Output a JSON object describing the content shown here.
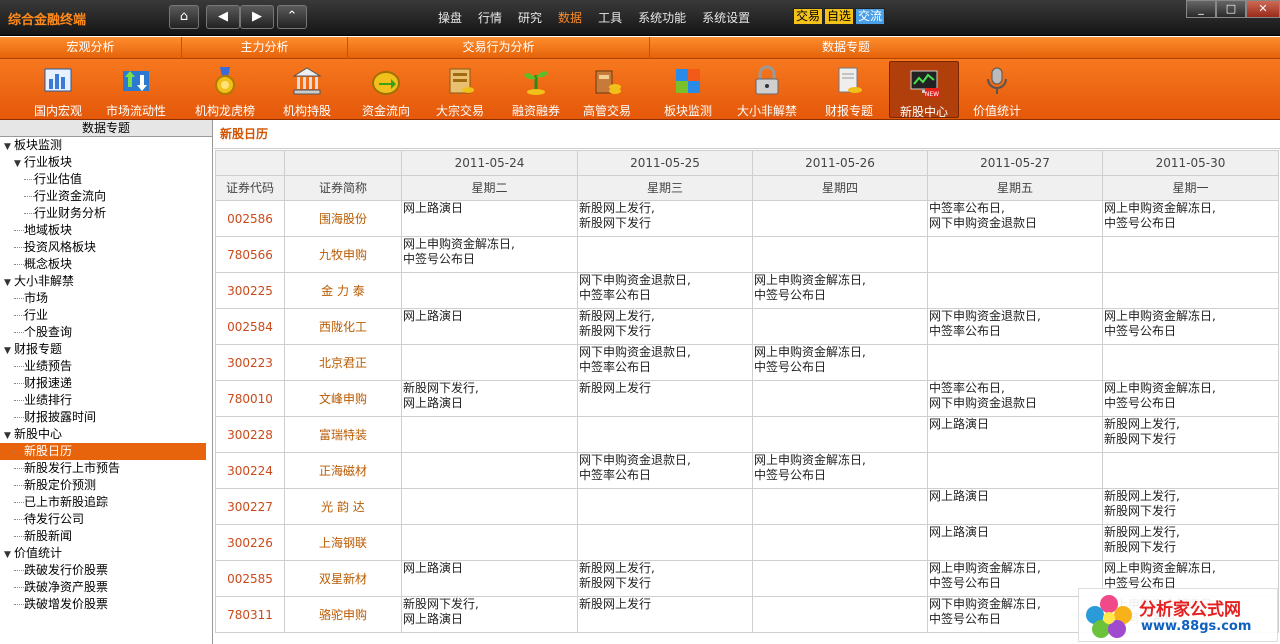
{
  "app_title": "综合金融终端",
  "nav_buttons": {
    "home": "⌂",
    "back": "◀",
    "forward": "▶",
    "up": "⌃"
  },
  "menu": [
    "操盘",
    "行情",
    "研究",
    "数据",
    "工具",
    "系统功能",
    "系统设置"
  ],
  "menu_active": "数据",
  "quick_buttons": [
    "交易",
    "自选",
    "交流"
  ],
  "window_controls": [
    "_",
    "□",
    "✕"
  ],
  "categories": [
    "宏观分析",
    "主力分析",
    "交易行为分析",
    "数据专题"
  ],
  "toolbar": [
    {
      "label": "国内宏观",
      "icon": "chart-bars-icon"
    },
    {
      "label": "市场流动性",
      "icon": "chart-arrows-icon"
    },
    {
      "label": "机构龙虎榜",
      "icon": "medal-icon"
    },
    {
      "label": "机构持股",
      "icon": "bank-building-icon"
    },
    {
      "label": "资金流向",
      "icon": "coin-arrow-icon"
    },
    {
      "label": "大宗交易",
      "icon": "gold-bars-icon"
    },
    {
      "label": "融资融券",
      "icon": "sprout-coins-icon"
    },
    {
      "label": "高管交易",
      "icon": "briefcase-coins-icon"
    },
    {
      "label": "板块监测",
      "icon": "blocks-icon"
    },
    {
      "label": "大小非解禁",
      "icon": "padlock-icon"
    },
    {
      "label": "财报专题",
      "icon": "report-coins-icon"
    },
    {
      "label": "新股中心",
      "icon": "monitor-new-icon",
      "badge": "NEW"
    },
    {
      "label": "价值统计",
      "icon": "microphone-icon"
    }
  ],
  "toolbar_active": "新股中心",
  "sidebar": {
    "title": "数据专题",
    "items": [
      {
        "label": "板块监测",
        "level": 0,
        "expanded": true
      },
      {
        "label": "行业板块",
        "level": 1,
        "expanded": true
      },
      {
        "label": "行业估值",
        "level": 2
      },
      {
        "label": "行业资金流向",
        "level": 2
      },
      {
        "label": "行业财务分析",
        "level": 2
      },
      {
        "label": "地域板块",
        "level": 1
      },
      {
        "label": "投资风格板块",
        "level": 1
      },
      {
        "label": "概念板块",
        "level": 1
      },
      {
        "label": "大小非解禁",
        "level": 0,
        "expanded": true
      },
      {
        "label": "市场",
        "level": 1
      },
      {
        "label": "行业",
        "level": 1
      },
      {
        "label": "个股查询",
        "level": 1
      },
      {
        "label": "财报专题",
        "level": 0,
        "expanded": true
      },
      {
        "label": "业绩预告",
        "level": 1
      },
      {
        "label": "财报速递",
        "level": 1
      },
      {
        "label": "业绩排行",
        "level": 1
      },
      {
        "label": "财报披露时间",
        "level": 1
      },
      {
        "label": "新股中心",
        "level": 0,
        "expanded": true
      },
      {
        "label": "新股日历",
        "level": 1,
        "selected": true
      },
      {
        "label": "新股发行上市预告",
        "level": 1
      },
      {
        "label": "新股定价预测",
        "level": 1
      },
      {
        "label": "已上市新股追踪",
        "level": 1
      },
      {
        "label": "待发行公司",
        "level": 1
      },
      {
        "label": "新股新闻",
        "level": 1
      },
      {
        "label": "价值统计",
        "level": 0,
        "expanded": true
      },
      {
        "label": "跌破发行价股票",
        "level": 1
      },
      {
        "label": "跌破净资产股票",
        "level": 1
      },
      {
        "label": "跌破增发价股票",
        "level": 1
      }
    ]
  },
  "main": {
    "title": "新股日历",
    "col_code": "证券代码",
    "col_name": "证券简称",
    "dates": [
      "2011-05-24",
      "2011-05-25",
      "2011-05-26",
      "2011-05-27",
      "2011-05-30"
    ],
    "weekdays": [
      "星期二",
      "星期三",
      "星期四",
      "星期五",
      "星期一"
    ],
    "rows": [
      {
        "code": "002586",
        "name": "围海股份",
        "events": [
          "网上路演日",
          "新股网上发行,\n新股网下发行",
          "",
          "中签率公布日,\n网下申购资金退款日",
          "网上申购资金解冻日,\n中签号公布日"
        ]
      },
      {
        "code": "780566",
        "name": "九牧申购",
        "events": [
          "网上申购资金解冻日,\n中签号公布日",
          "",
          "",
          "",
          ""
        ]
      },
      {
        "code": "300225",
        "name": "金 力 泰",
        "events": [
          "",
          "网下申购资金退款日,\n中签率公布日",
          "网上申购资金解冻日,\n中签号公布日",
          "",
          ""
        ]
      },
      {
        "code": "002584",
        "name": "西陇化工",
        "events": [
          "网上路演日",
          "新股网上发行,\n新股网下发行",
          "",
          "网下申购资金退款日,\n中签率公布日",
          "网上申购资金解冻日,\n中签号公布日"
        ]
      },
      {
        "code": "300223",
        "name": "北京君正",
        "events": [
          "",
          "网下申购资金退款日,\n中签率公布日",
          "网上申购资金解冻日,\n中签号公布日",
          "",
          ""
        ]
      },
      {
        "code": "780010",
        "name": "文峰申购",
        "events": [
          "新股网下发行,\n网上路演日",
          "新股网上发行",
          "",
          "中签率公布日,\n网下申购资金退款日",
          "网上申购资金解冻日,\n中签号公布日"
        ]
      },
      {
        "code": "300228",
        "name": "富瑞特装",
        "events": [
          "",
          "",
          "",
          "网上路演日",
          "新股网上发行,\n新股网下发行"
        ]
      },
      {
        "code": "300224",
        "name": "正海磁材",
        "events": [
          "",
          "网下申购资金退款日,\n中签率公布日",
          "网上申购资金解冻日,\n中签号公布日",
          "",
          ""
        ]
      },
      {
        "code": "300227",
        "name": "光 韵 达",
        "events": [
          "",
          "",
          "",
          "网上路演日",
          "新股网上发行,\n新股网下发行"
        ]
      },
      {
        "code": "300226",
        "name": "上海钢联",
        "events": [
          "",
          "",
          "",
          "网上路演日",
          "新股网上发行,\n新股网下发行"
        ]
      },
      {
        "code": "002585",
        "name": "双星新材",
        "events": [
          "网上路演日",
          "新股网上发行,\n新股网下发行",
          "",
          "网上申购资金解冻日,\n中签号公布日",
          "网上申购资金解冻日,\n中签号公布日"
        ]
      },
      {
        "code": "780311",
        "name": "骆驼申购",
        "events": [
          "新股网下发行,\n网上路演日",
          "新股网上发行",
          "",
          "网下申购资金解冻日,\n中签号公布日",
          "网上申购资金解冻日,\n中签号公布日"
        ]
      }
    ]
  },
  "watermark": {
    "text": "分析家公式网",
    "url": "www.88gs.com"
  },
  "colors": {
    "accent": "#e8640c",
    "title_orange": "#ff8a1a",
    "code_red": "#cc4a1a"
  }
}
